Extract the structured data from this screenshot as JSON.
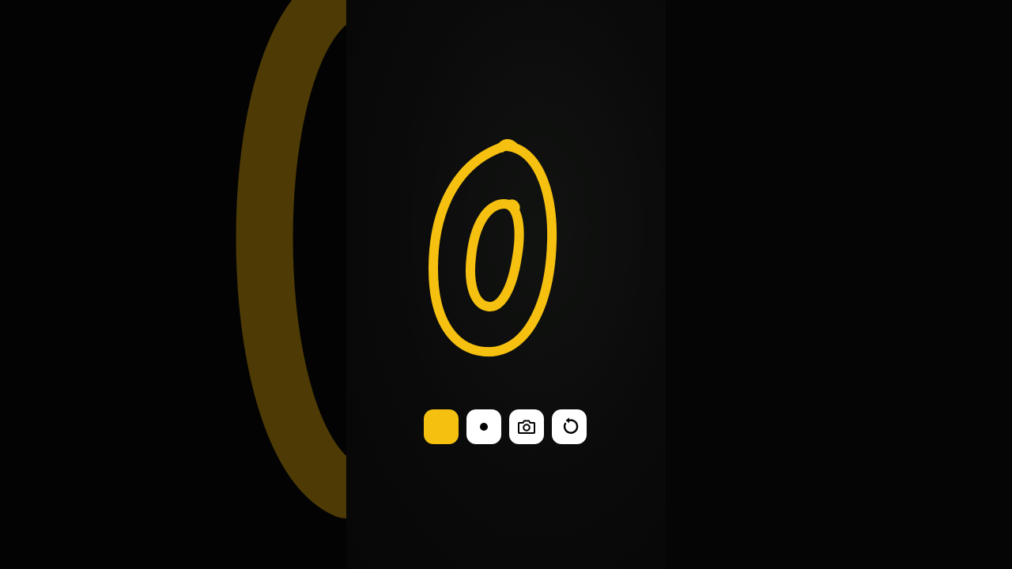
{
  "canvas": {
    "background": "#060606",
    "stroke_color": "#f5c010",
    "blurred_stroke_color": "#4d3a05"
  },
  "toolbar": {
    "items": [
      {
        "name": "color-swatch",
        "icon": "yellow-swatch",
        "color": "#f5c010"
      },
      {
        "name": "brush-size",
        "icon": "dot-icon"
      },
      {
        "name": "snapshot",
        "icon": "camera-icon"
      },
      {
        "name": "reset",
        "icon": "undo-rotate-icon"
      }
    ]
  }
}
